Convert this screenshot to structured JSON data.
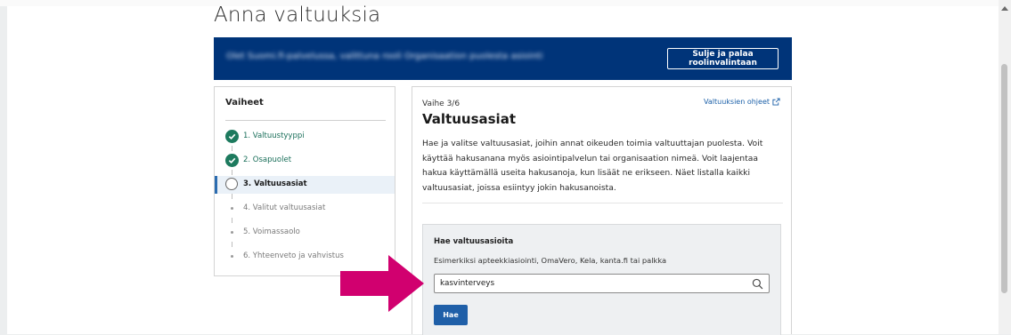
{
  "page": {
    "title": "Anna valtuuksia"
  },
  "banner": {
    "blurred_text": "Olet Suomi.fi-palvelussa, valittuna rooli Organisaation puolesta asiointi",
    "close_button": "Sulje ja palaa roolinvalintaan"
  },
  "steps": {
    "title": "Vaiheet",
    "items": [
      {
        "label": "1. Valtuustyyppi",
        "state": "done"
      },
      {
        "label": "2. Osapuolet",
        "state": "done"
      },
      {
        "label": "3. Valtuusasiat",
        "state": "current"
      },
      {
        "label": "4. Valitut valtuusasiat",
        "state": "future"
      },
      {
        "label": "5. Voimassaolo",
        "state": "future"
      },
      {
        "label": "6. Yhteenveto ja vahvistus",
        "state": "future"
      }
    ]
  },
  "main": {
    "phase": "Vaihe 3/6",
    "help_link": "Valtuuksien ohjeet",
    "title": "Valtuusasiat",
    "description": "Hae ja valitse valtuusasiat, joihin annat oikeuden toimia valtuuttajan puolesta. Voit käyttää hakusanana myös asiointipalvelun tai organisaation nimeä. Voit laajentaa hakua käyttämällä useita hakusanoja, kun lisäät ne erikseen. Näet listalla kaikki valtuusasiat, joissa esiintyy jokin hakusanoista.",
    "search": {
      "label": "Hae valtuusasioita",
      "hint": "Esimerkiksi apteekkiasiointi, OmaVero, Kela, kanta.fi tai palkka",
      "value": "kasvinterveys",
      "button": "Hae"
    }
  },
  "colors": {
    "banner": "#003479",
    "done": "#1d7a5e",
    "link": "#1a5fa8",
    "button": "#1f5fa8",
    "arrow": "#d1006f"
  }
}
